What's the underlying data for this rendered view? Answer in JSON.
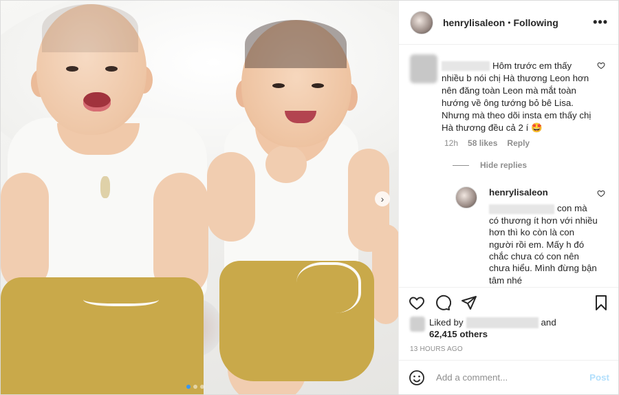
{
  "header": {
    "username": "henrylisaleon",
    "separator": "•",
    "follow_status": "Following",
    "more_label": "•••"
  },
  "comment": {
    "text": "Hôm trước em thấy nhiều b nói chị Hà thương Leon hơn nên đăng toàn Leon mà mắt toàn hướng về ông tướng bỏ bê Lisa. Nhưng mà theo dõi insta em thấy chị Hà thương đều cả 2 í 🤩",
    "time": "12h",
    "likes": "58 likes",
    "reply_label": "Reply",
    "hide_replies": "Hide replies"
  },
  "reply": {
    "username": "henrylisaleon",
    "text": "con mà có thương ít hơn với nhiều hơn thì ko còn là con người rồi em. Mấy h đó chắc chưa có con nên chưa hiểu. Mình đừng bận tâm nhé"
  },
  "likes": {
    "prefix": "Liked by",
    "and": "and",
    "count": "62,415 others"
  },
  "timestamp": "13 HOURS AGO",
  "add_comment": {
    "placeholder": "Add a comment...",
    "post_label": "Post"
  },
  "carousel": {
    "next_label": "›",
    "slides": 3,
    "active_slide": 1
  },
  "colors": {
    "accent_blue": "#3897f0",
    "post_disabled": "#b2dffc",
    "muted": "#8e8e8e",
    "text": "#262626"
  }
}
